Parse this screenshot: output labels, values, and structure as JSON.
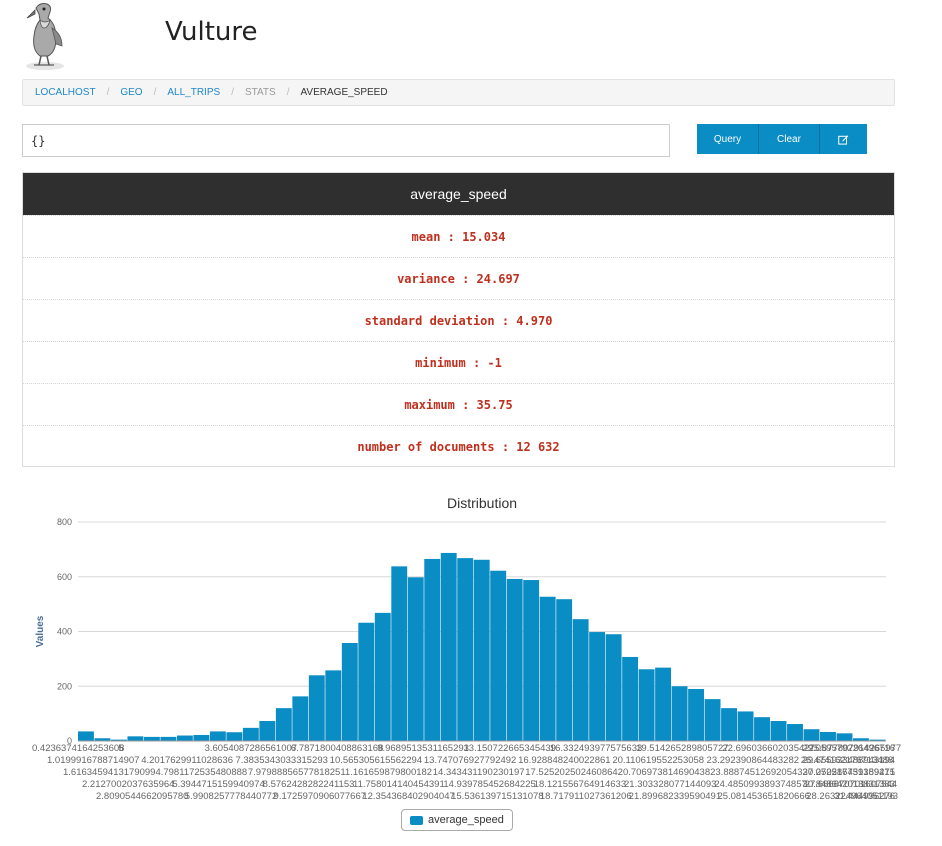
{
  "app": {
    "title": "Vulture"
  },
  "breadcrumb": [
    "LOCALHOST",
    "GEO",
    "ALL_TRIPS",
    "STATS",
    "AVERAGE_SPEED"
  ],
  "query": {
    "value": "{}"
  },
  "buttons": {
    "query": "Query",
    "clear": "Clear",
    "edit_icon": "edit-icon"
  },
  "stats": {
    "field": "average_speed",
    "rows": [
      "mean : 15.034",
      "variance : 24.697",
      "standard deviation : 4.970",
      "minimum : -1",
      "maximum : 35.75",
      "number of documents : 12 632"
    ]
  },
  "colors": {
    "accent": "#0a8cc4",
    "stat_text": "#c0301e",
    "header_bg": "#2f2f2f"
  },
  "chart_data": {
    "type": "bar",
    "title": "Distribution",
    "ylabel": "Values",
    "ylim": [
      0,
      800
    ],
    "yticks": [
      0,
      200,
      400,
      600,
      800
    ],
    "series": [
      {
        "name": "average_speed",
        "values": [
          35,
          10,
          5,
          17,
          15,
          15,
          20,
          22,
          35,
          32,
          48,
          73,
          120,
          163,
          240,
          258,
          358,
          432,
          468,
          638,
          598,
          665,
          687,
          668,
          662,
          622,
          592,
          588,
          527,
          518,
          445,
          398,
          390,
          307,
          262,
          268,
          200,
          190,
          153,
          120,
          108,
          87,
          73,
          62,
          43,
          33,
          28,
          10,
          5
        ]
      }
    ],
    "x_tick_rows": [
      [
        "0.4236374164253608",
        "5",
        "3.6054087286561007",
        "6.7871800408863168",
        "9.9689513531165293",
        "13.150722665345439",
        "16.332493977575633",
        "19.514265289805727",
        "22.696036602035427",
        "25.877807914265977",
        "29.059579226496716"
      ],
      [
        "1.0199916788714907",
        "4.2017629911028636",
        "7.3835343033315293",
        "10.565305615562294",
        "13.747076927792492",
        "16.928848240022861",
        "20.110619552253058",
        "23.292390864483282",
        "26.474162176713488",
        "29.655933488943194"
      ],
      [
        "1.6163459413179099",
        "4.7981172535480888",
        "7.9798885657781825",
        "11.161659879800182",
        "14.343431190230197",
        "17.525202502460864",
        "20.706973814690438",
        "23.888745126920543",
        "27.070516439159471",
        "30.252287751389215"
      ],
      [
        "2.2127002037635964",
        "5.3944715159940974",
        "8.5762428282241153",
        "11.758014140454391",
        "14.939785452684225",
        "18.121556764914633",
        "21.303328077144093",
        "24.485099389374857",
        "27.666870701607544",
        "30.848642013831383"
      ],
      [
        "2.8090544662095780",
        "5.9908257778440772",
        "9.1725970906077667",
        "12.354368402904047",
        "15.536139715131078",
        "18.717911027361206",
        "21.899682339590491",
        "25.081453651820666",
        "28.263224964051193",
        "31.444996276"
      ]
    ],
    "grid": true,
    "legend": "bottom-center"
  }
}
